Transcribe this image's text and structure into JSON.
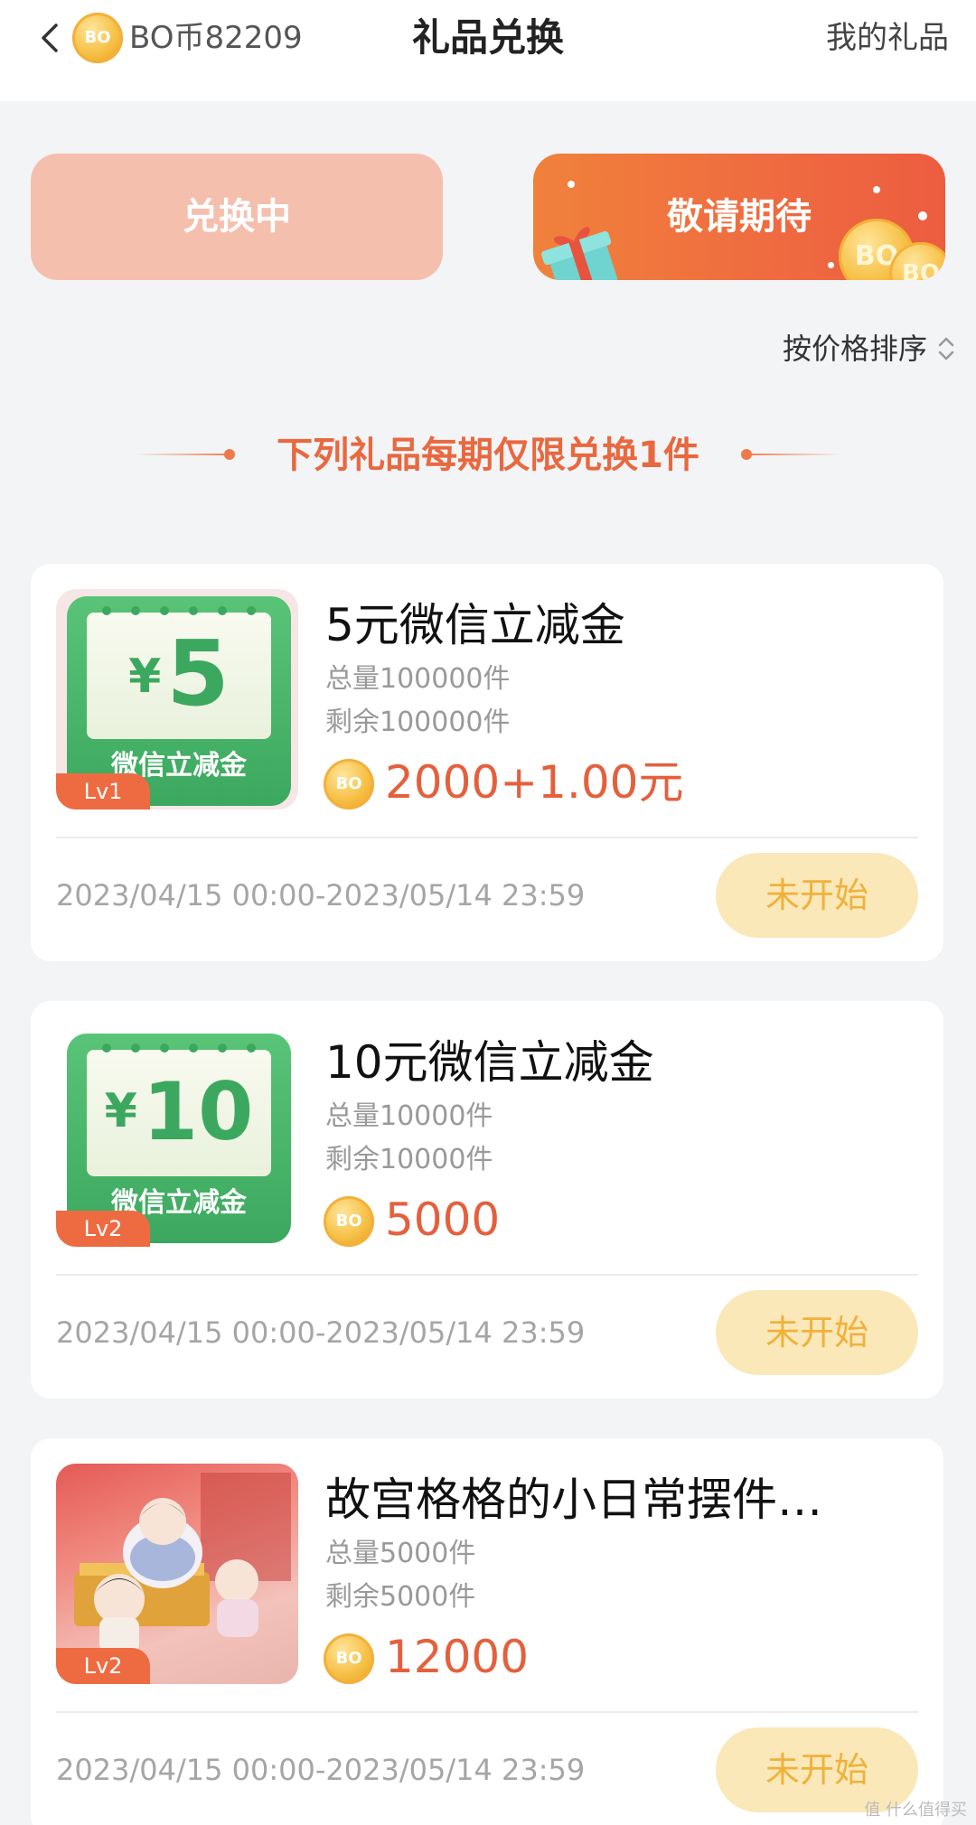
{
  "header": {
    "coin_icon": "BO",
    "balance": "BO币82209",
    "title": "礼品兑换",
    "right_link": "我的礼品"
  },
  "tabs": [
    {
      "label": "兑换中",
      "active": true
    },
    {
      "label": "敬请期待",
      "active": false
    }
  ],
  "sort_label": "按价格排序",
  "notice": "下列礼品每期仅限兑换1件",
  "gifts": [
    {
      "title": "5元微信立减金",
      "total": "总量100000件",
      "remaining": "剩余100000件",
      "price": "2000+1.00元",
      "level": "Lv1",
      "voucher_yen": "¥",
      "voucher_amount": "5",
      "voucher_text": "微信立减金",
      "period": "2023/04/15 00:00-2023/05/14 23:59",
      "button": "未开始"
    },
    {
      "title": "10元微信立减金",
      "total": "总量10000件",
      "remaining": "剩余10000件",
      "price": "5000",
      "level": "Lv2",
      "voucher_yen": "¥",
      "voucher_amount": "10",
      "voucher_text": "微信立减金",
      "period": "2023/04/15 00:00-2023/05/14 23:59",
      "button": "未开始"
    },
    {
      "title": "故宫格格的小日常摆件…",
      "total": "总量5000件",
      "remaining": "剩余5000件",
      "price": "12000",
      "level": "Lv2",
      "period": "2023/04/15 00:00-2023/05/14 23:59",
      "button": "未开始"
    }
  ],
  "watermark": "值 什么值得买",
  "colors": {
    "accent": "#e4603d",
    "tab_inactive": "#f5bfae",
    "button_bg": "#fbe8b9",
    "button_text": "#f0b13b"
  }
}
